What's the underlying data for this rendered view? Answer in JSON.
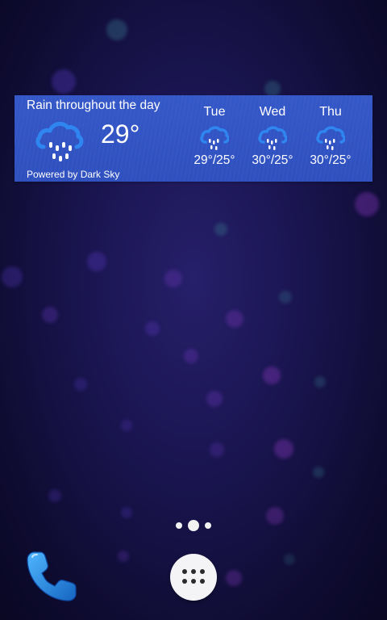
{
  "weather_widget": {
    "summary": "Rain throughout the day",
    "current_temp": "29°",
    "current_icon": "rain-cloud-icon",
    "powered_by": "Powered by Dark Sky",
    "forecast": [
      {
        "day": "Tue",
        "temps": "29°/25°",
        "icon": "rain-cloud-icon"
      },
      {
        "day": "Wed",
        "temps": "30°/25°",
        "icon": "rain-cloud-icon"
      },
      {
        "day": "Thu",
        "temps": "30°/25°",
        "icon": "rain-cloud-icon"
      }
    ]
  },
  "home_screen": {
    "page_count": 3,
    "current_page": 2
  },
  "dock": {
    "phone_icon": "phone-handset-icon",
    "app_drawer_icon": "app-drawer-icon"
  },
  "colors": {
    "widget_bg": "#3254c4",
    "icon_blue": "#2f86f0",
    "phone_blue": "#1e88e5",
    "wallpaper": "#1a1550"
  }
}
